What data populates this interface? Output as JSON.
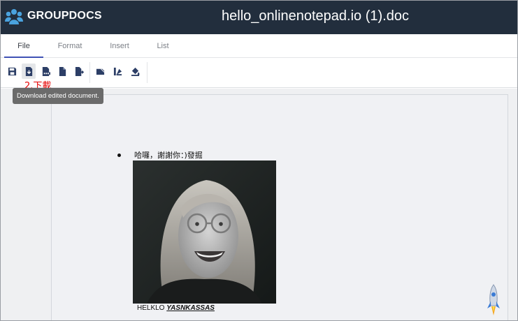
{
  "header": {
    "brand": "GROUPDOCS",
    "doc_title": "hello_onlinenotepad.io (1).doc"
  },
  "tabs": [
    {
      "label": "File",
      "active": true
    },
    {
      "label": "Format",
      "active": false
    },
    {
      "label": "Insert",
      "active": false
    },
    {
      "label": "List",
      "active": false
    }
  ],
  "toolbar": {
    "buttons": [
      {
        "icon": "save-icon"
      },
      {
        "icon": "download-icon",
        "pressed": true
      },
      {
        "icon": "pdf-file-icon"
      },
      {
        "icon": "file-icon"
      },
      {
        "icon": "export-icon"
      },
      {
        "icon": "highlight-icon"
      },
      {
        "icon": "paint-format-icon"
      },
      {
        "icon": "fill-color-icon"
      }
    ],
    "annotation": "2.下載",
    "tooltip": "Download edited document."
  },
  "document": {
    "list_item": "哈囉，謝謝你：)發掘",
    "caption_prefix": "HELKLO ",
    "caption_emphasis": "YASNKASSAS"
  },
  "colors": {
    "header_bg": "#222e3d",
    "accent": "#3f51b5",
    "annotation": "#e60000",
    "toolbar_icon": "#2c3e66"
  }
}
